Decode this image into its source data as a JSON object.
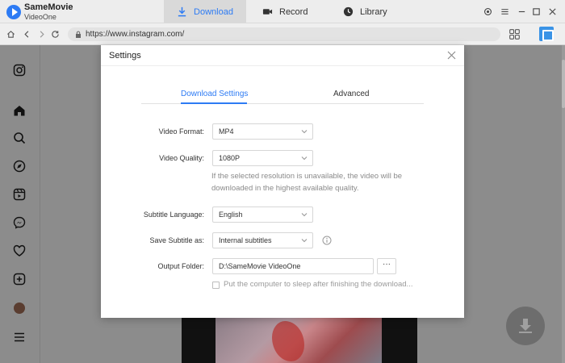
{
  "app": {
    "name": "SameMovie",
    "sub": "VideoOne"
  },
  "tabs": {
    "download": "Download",
    "record": "Record",
    "library": "Library"
  },
  "address": {
    "url": "https://www.instagram.com/"
  },
  "sidebar": {
    "icons": [
      "instagram-icon",
      "home-icon",
      "search-icon",
      "explore-icon",
      "reels-icon",
      "messenger-icon",
      "heart-icon",
      "create-icon",
      "avatar",
      "menu-icon"
    ]
  },
  "dialog": {
    "title": "Settings",
    "tabs": {
      "download_settings": "Download Settings",
      "advanced": "Advanced"
    },
    "video_format": {
      "label": "Video Format:",
      "value": "MP4"
    },
    "video_quality": {
      "label": "Video Quality:",
      "value": "1080P"
    },
    "quality_hint": "If the selected resolution is unavailable, the video will be downloaded in the highest available quality.",
    "subtitle_language": {
      "label": "Subtitle Language:",
      "value": "English"
    },
    "save_subtitle": {
      "label": "Save Subtitle as:",
      "value": "Internal subtitles"
    },
    "output_folder": {
      "label": "Output Folder:",
      "value": "D:\\SameMovie VideoOne",
      "browse": "···"
    },
    "sleep_checkbox": {
      "label": "Put the computer to sleep after finishing the download...",
      "checked": false
    }
  },
  "colors": {
    "accent": "#2d7bf4",
    "overlay": "#8c8c8c"
  }
}
